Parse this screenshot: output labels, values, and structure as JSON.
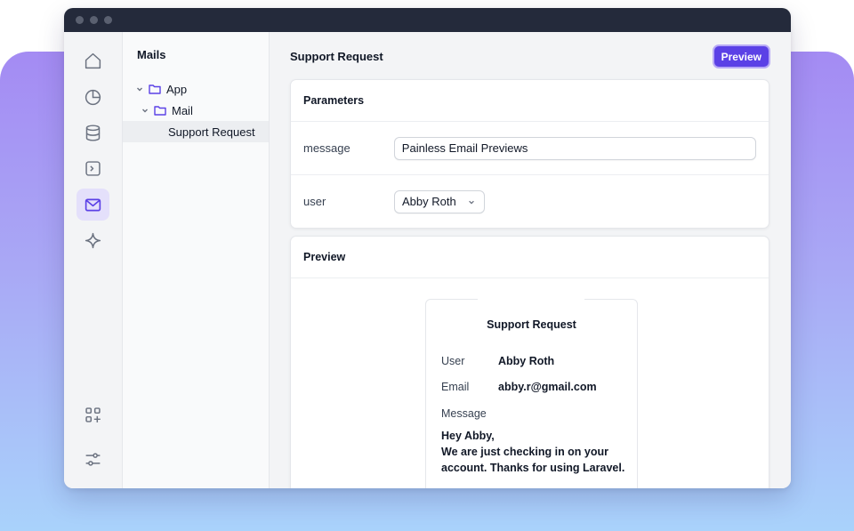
{
  "colors": {
    "accent": "#5b41e6",
    "titlebar": "#242a3b",
    "active_rail": "#e4e0fb"
  },
  "rail": {
    "items": [
      {
        "icon": "home-icon"
      },
      {
        "icon": "pie-chart-icon"
      },
      {
        "icon": "database-icon"
      },
      {
        "icon": "terminal-icon"
      },
      {
        "icon": "mail-icon",
        "active": true
      },
      {
        "icon": "sparkle-icon"
      }
    ],
    "bottom": [
      {
        "icon": "add-widget-icon"
      },
      {
        "icon": "sliders-icon"
      }
    ]
  },
  "tree": {
    "title": "Mails",
    "items": [
      {
        "label": "App"
      },
      {
        "label": "Mail"
      },
      {
        "label": "Support Request"
      }
    ]
  },
  "main": {
    "title": "Support Request",
    "preview_button": "Preview",
    "parameters": {
      "title": "Parameters",
      "message_label": "message",
      "message_value": "Painless Email Previews",
      "user_label": "user",
      "user_value": "Abby Roth"
    },
    "preview": {
      "title": "Preview",
      "email": {
        "title": "Support Request",
        "user_label": "User",
        "user_value": "Abby Roth",
        "email_label": "Email",
        "email_value": "abby.r@gmail.com",
        "message_label": "Message",
        "greeting": "Hey Abby,",
        "body": "We are just checking in on your account. Thanks for using Laravel."
      }
    }
  }
}
